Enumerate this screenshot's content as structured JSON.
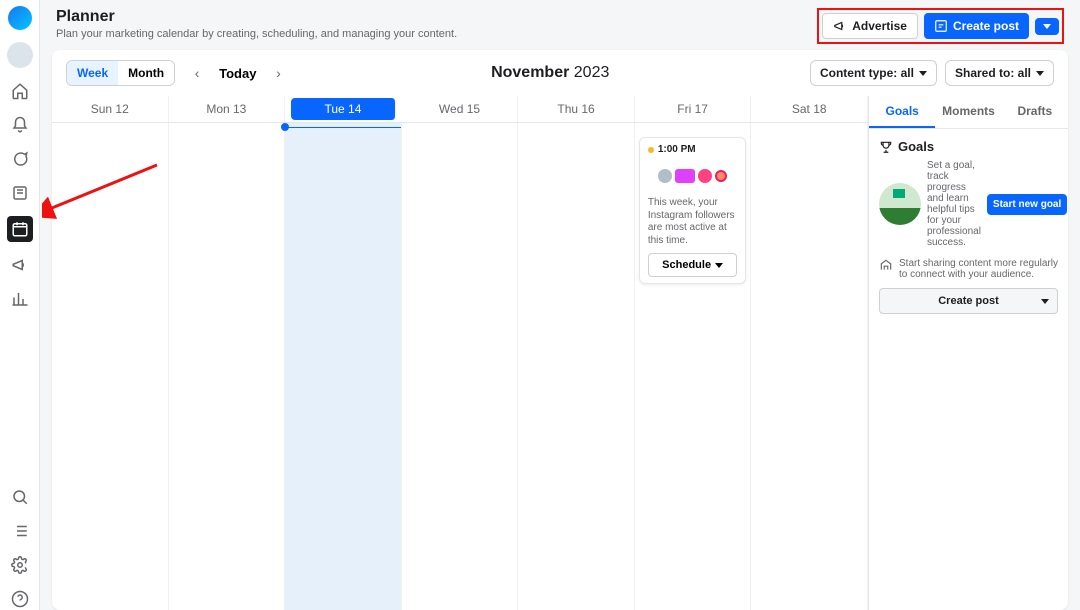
{
  "header": {
    "title": "Planner",
    "subtitle": "Plan your marketing calendar by creating, scheduling, and managing your content.",
    "advertise": "Advertise",
    "create_post": "Create post"
  },
  "calendar": {
    "view_week": "Week",
    "view_month": "Month",
    "today": "Today",
    "month_label": "November",
    "year_label": "2023",
    "content_type_label": "Content type: all",
    "shared_to_label": "Shared to: all",
    "days": [
      {
        "label": "Sun 12",
        "active": false
      },
      {
        "label": "Mon 13",
        "active": false
      },
      {
        "label": "Tue 14",
        "active": true
      },
      {
        "label": "Wed 15",
        "active": false
      },
      {
        "label": "Thu 16",
        "active": false
      },
      {
        "label": "Fri 17",
        "active": false
      },
      {
        "label": "Sat 18",
        "active": false
      }
    ],
    "event": {
      "time": "1:00 PM",
      "text": "This week, your Instagram followers are most active at this time.",
      "schedule": "Schedule"
    }
  },
  "right": {
    "tabs": {
      "goals": "Goals",
      "moments": "Moments",
      "drafts": "Drafts"
    },
    "goals_heading": "Goals",
    "goals_desc": "Set a goal, track progress and learn helpful tips for your professional success.",
    "start_goal": "Start new goal",
    "tip": "Start sharing content more regularly to connect with your audience.",
    "create_post": "Create post"
  },
  "leftbar": {
    "items": [
      "home",
      "notifications",
      "inbox",
      "posts",
      "planner",
      "ads",
      "insights"
    ],
    "bottom": [
      "search",
      "list",
      "settings",
      "help"
    ]
  }
}
